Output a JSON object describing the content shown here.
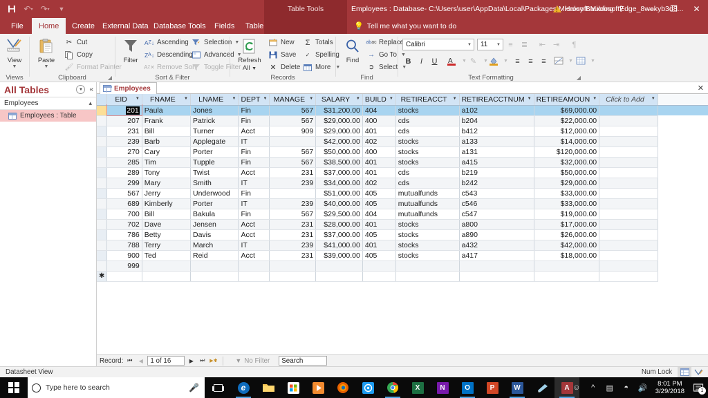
{
  "titlebar": {
    "quick_access": [
      "save-icon",
      "undo-icon",
      "redo-icon",
      "customize-icon"
    ],
    "contextual_group": "Table Tools",
    "document_title": "Employees : Database- C:\\Users\\user\\AppData\\Local\\Packages\\Microsoft.MicrosoftEdge_8wekyb3d8...",
    "account_name": "Haley Baulding",
    "help_label": "?",
    "minimize_label": "—",
    "restore_label": "❐",
    "close_label": "✕"
  },
  "ribbon": {
    "tabs": [
      {
        "label": "File",
        "active": false
      },
      {
        "label": "Home",
        "active": true
      },
      {
        "label": "Create",
        "active": false
      },
      {
        "label": "External Data",
        "active": false
      },
      {
        "label": "Database Tools",
        "active": false
      },
      {
        "label": "Fields",
        "active": false
      },
      {
        "label": "Table",
        "active": false
      }
    ],
    "tellme": "Tell me what you want to do",
    "groups": {
      "views": {
        "label": "Views",
        "view_button": "View"
      },
      "clipboard": {
        "label": "Clipboard",
        "paste": "Paste",
        "cut": "Cut",
        "copy": "Copy",
        "format_painter": "Format Painter"
      },
      "sort_filter": {
        "label": "Sort & Filter",
        "filter": "Filter",
        "ascending": "Ascending",
        "descending": "Descending",
        "remove_sort": "Remove Sort",
        "selection": "Selection",
        "advanced": "Advanced",
        "toggle_filter": "Toggle Filter"
      },
      "records": {
        "label": "Records",
        "refresh_all": "Refresh",
        "refresh_all_2": "All",
        "new": "New",
        "save": "Save",
        "delete": "Delete",
        "totals": "Totals",
        "spelling": "Spelling",
        "more": "More"
      },
      "find": {
        "label": "Find",
        "find": "Find",
        "replace": "Replace",
        "goto": "Go To",
        "select": "Select"
      },
      "text_formatting": {
        "label": "Text Formatting",
        "font_name": "Calibri",
        "font_size": "11",
        "bold": "B",
        "italic": "I",
        "underline": "U"
      }
    }
  },
  "navpane": {
    "title": "All Tables",
    "group_label": "Employees",
    "item_label": "Employees : Table"
  },
  "doctab": {
    "label": "Employees",
    "close_label": "✕"
  },
  "table": {
    "columns": [
      "EID",
      "FNAME",
      "LNAME",
      "DEPT",
      "MANAGE",
      "SALARY",
      "BUILD",
      "RETIREACCT",
      "RETIREACCTNUM",
      "RETIREAMOUN",
      "Click to Add"
    ],
    "selected_column": "EID",
    "rows": [
      {
        "eid": "201",
        "fname": "Paula",
        "lname": "Jones",
        "dept": "Fin",
        "manage": "567",
        "salary": "$31,200.00",
        "build": "404",
        "retireacct": "stocks",
        "retireacctnum": "a102",
        "retireamount": "$69,000.00"
      },
      {
        "eid": "207",
        "fname": "Frank",
        "lname": "Patrick",
        "dept": "Fin",
        "manage": "567",
        "salary": "$29,000.00",
        "build": "400",
        "retireacct": "cds",
        "retireacctnum": "b204",
        "retireamount": "$22,000.00"
      },
      {
        "eid": "231",
        "fname": "Bill",
        "lname": "Turner",
        "dept": "Acct",
        "manage": "909",
        "salary": "$29,000.00",
        "build": "401",
        "retireacct": "cds",
        "retireacctnum": "b412",
        "retireamount": "$12,000.00"
      },
      {
        "eid": "239",
        "fname": "Barb",
        "lname": "Applegate",
        "dept": "IT",
        "manage": "",
        "salary": "$42,000.00",
        "build": "402",
        "retireacct": "stocks",
        "retireacctnum": "a133",
        "retireamount": "$14,000.00"
      },
      {
        "eid": "270",
        "fname": "Cary",
        "lname": "Porter",
        "dept": "Fin",
        "manage": "567",
        "salary": "$50,000.00",
        "build": "400",
        "retireacct": "stocks",
        "retireacctnum": "a131",
        "retireamount": "$120,000.00"
      },
      {
        "eid": "285",
        "fname": "Tim",
        "lname": "Tupple",
        "dept": "Fin",
        "manage": "567",
        "salary": "$38,500.00",
        "build": "401",
        "retireacct": "stocks",
        "retireacctnum": "a415",
        "retireamount": "$32,000.00"
      },
      {
        "eid": "289",
        "fname": "Tony",
        "lname": "Twist",
        "dept": "Acct",
        "manage": "231",
        "salary": "$37,000.00",
        "build": "401",
        "retireacct": "cds",
        "retireacctnum": "b219",
        "retireamount": "$50,000.00"
      },
      {
        "eid": "299",
        "fname": "Mary",
        "lname": "Smith",
        "dept": "IT",
        "manage": "239",
        "salary": "$34,000.00",
        "build": "402",
        "retireacct": "cds",
        "retireacctnum": "b242",
        "retireamount": "$29,000.00"
      },
      {
        "eid": "567",
        "fname": "Jerry",
        "lname": "Underwood",
        "dept": "Fin",
        "manage": "",
        "salary": "$51,000.00",
        "build": "405",
        "retireacct": "mutualfunds",
        "retireacctnum": "c543",
        "retireamount": "$33,000.00"
      },
      {
        "eid": "689",
        "fname": "Kimberly",
        "lname": "Porter",
        "dept": "IT",
        "manage": "239",
        "salary": "$40,000.00",
        "build": "405",
        "retireacct": "mutualfunds",
        "retireacctnum": "c546",
        "retireamount": "$33,000.00"
      },
      {
        "eid": "700",
        "fname": "Bill",
        "lname": "Bakula",
        "dept": "Fin",
        "manage": "567",
        "salary": "$29,500.00",
        "build": "404",
        "retireacct": "mutualfunds",
        "retireacctnum": "c547",
        "retireamount": "$19,000.00"
      },
      {
        "eid": "702",
        "fname": "Dave",
        "lname": "Jensen",
        "dept": "Acct",
        "manage": "231",
        "salary": "$28,000.00",
        "build": "401",
        "retireacct": "stocks",
        "retireacctnum": "a800",
        "retireamount": "$17,000.00"
      },
      {
        "eid": "786",
        "fname": "Betty",
        "lname": "Davis",
        "dept": "Acct",
        "manage": "231",
        "salary": "$37,000.00",
        "build": "405",
        "retireacct": "stocks",
        "retireacctnum": "a890",
        "retireamount": "$26,000.00"
      },
      {
        "eid": "788",
        "fname": "Terry",
        "lname": "March",
        "dept": "IT",
        "manage": "239",
        "salary": "$41,000.00",
        "build": "401",
        "retireacct": "stocks",
        "retireacctnum": "a432",
        "retireamount": "$42,000.00"
      },
      {
        "eid": "900",
        "fname": "Ted",
        "lname": "Reid",
        "dept": "Acct",
        "manage": "231",
        "salary": "$39,000.00",
        "build": "405",
        "retireacct": "stocks",
        "retireacctnum": "a417",
        "retireamount": "$18,000.00"
      },
      {
        "eid": "999",
        "fname": "",
        "lname": "",
        "dept": "",
        "manage": "",
        "salary": "",
        "build": "",
        "retireacct": "",
        "retireacctnum": "",
        "retireamount": ""
      }
    ]
  },
  "recordnav": {
    "label": "Record:",
    "first": "⏮",
    "prev": "◀",
    "position": "1 of 16",
    "next": "▶",
    "last": "⏭",
    "new_record": "▶✱",
    "filter_status": "No Filter",
    "search_placeholder": "Search"
  },
  "statusbar": {
    "view_mode": "Datasheet View",
    "num_lock": "Num Lock",
    "datasheet_view_icon": "datasheet-view-icon",
    "design_view_icon": "design-view-icon"
  },
  "taskbar": {
    "search_placeholder": "Type here to search",
    "apps": [
      {
        "name": "edge",
        "glyph": "e",
        "color": "#0f6cbd",
        "open": true
      },
      {
        "name": "file-explorer",
        "glyph": "▬",
        "color": "#f2c14e",
        "open": false
      },
      {
        "name": "microsoft-store",
        "glyph": "⊞",
        "color": "#ffffff",
        "open": false
      },
      {
        "name": "media-player",
        "glyph": "▶",
        "color": "#f28b30",
        "open": false
      },
      {
        "name": "firefox",
        "glyph": "◉",
        "color": "#e66000",
        "open": false
      },
      {
        "name": "teamviewer",
        "glyph": "◎",
        "color": "#1d9bf0",
        "open": false
      },
      {
        "name": "chrome",
        "glyph": "●",
        "color": "#34a853",
        "open": true
      },
      {
        "name": "excel",
        "glyph": "X",
        "color": "#1d6f42",
        "open": false
      },
      {
        "name": "onenote",
        "glyph": "N",
        "color": "#7719aa",
        "open": false
      },
      {
        "name": "outlook",
        "glyph": "O",
        "color": "#0072c6",
        "open": true
      },
      {
        "name": "powerpoint",
        "glyph": "P",
        "color": "#d24726",
        "open": false
      },
      {
        "name": "word",
        "glyph": "W",
        "color": "#2b579a",
        "open": true
      },
      {
        "name": "sticky-notes",
        "glyph": "▱",
        "color": "#9fd0e8",
        "open": false
      },
      {
        "name": "access",
        "glyph": "A",
        "color": "#a4373a",
        "open": true
      }
    ],
    "tray": {
      "people_icon": "people-icon",
      "chevron_icon": "chevron-up-icon",
      "battery_icon": "battery-icon",
      "wifi_icon": "wifi-icon",
      "volume_icon": "volume-icon",
      "time": "8:01 PM",
      "date": "3/29/2018",
      "notification_count": "1"
    }
  }
}
